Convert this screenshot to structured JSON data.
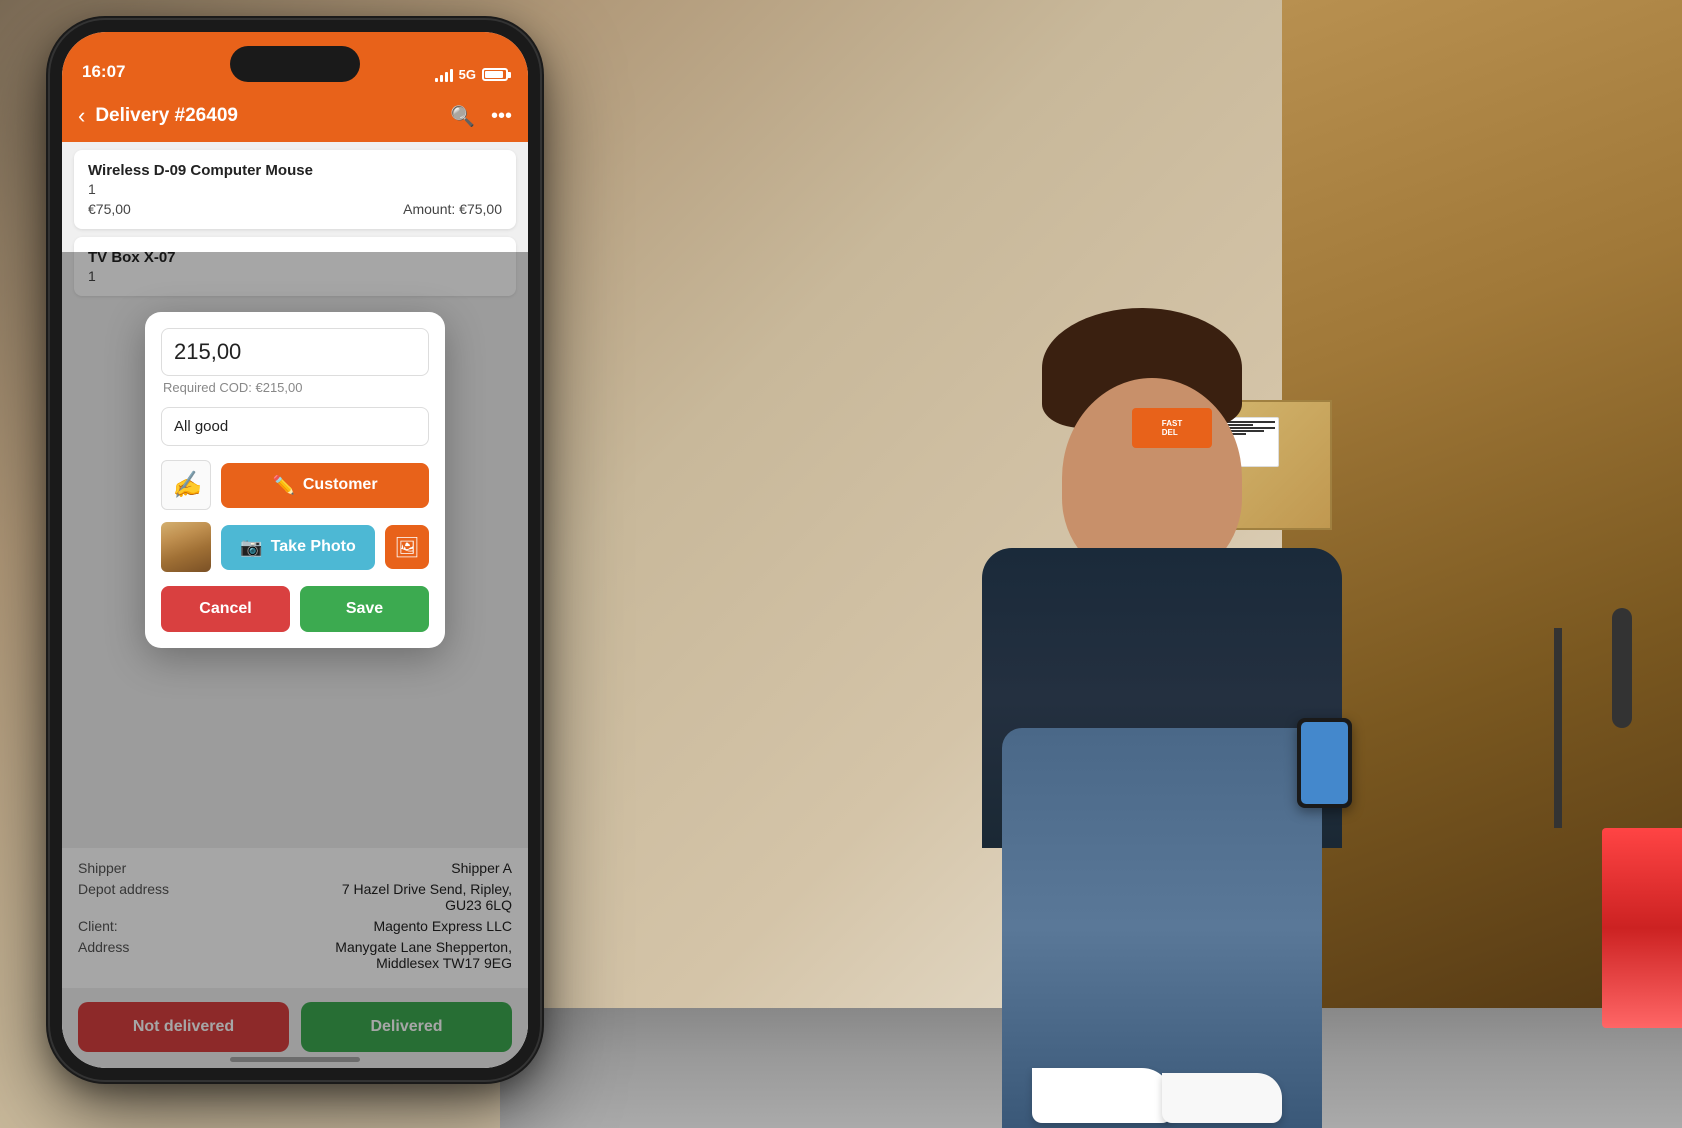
{
  "background": {
    "alt": "Delivery person sitting in van with packages"
  },
  "phone": {
    "status_bar": {
      "time": "16:07",
      "signal": "5G",
      "battery": "90"
    },
    "nav": {
      "title": "Delivery #26409",
      "back_label": "‹",
      "search_icon": "search",
      "more_icon": "•••"
    },
    "items": [
      {
        "name": "Wireless D-09 Computer Mouse",
        "qty": "1",
        "price": "€75,00",
        "amount_label": "Amount:",
        "amount": "€75,00"
      },
      {
        "name": "TV Box X-07",
        "qty": "1"
      }
    ],
    "modal": {
      "amount_value": "215,00",
      "cod_hint": "Required COD: €215,00",
      "notes_value": "All good",
      "signature_placeholder": "✍",
      "customer_btn_label": "Customer",
      "take_photo_btn_label": "Take Photo",
      "add_photo_icon": "🖼",
      "cancel_btn_label": "Cancel",
      "save_btn_label": "Save"
    },
    "info": [
      {
        "label": "Shipper",
        "value": "Shipper A"
      },
      {
        "label": "Depot address",
        "value": "7 Hazel Drive Send, Ripley, GU23 6LQ"
      },
      {
        "label": "Client:",
        "value": "Magento Express LLC"
      },
      {
        "label": "Address",
        "value": "Manygate Lane Shepperton, Middlesex TW17 9EG"
      }
    ],
    "bottom_buttons": {
      "not_delivered": "Not delivered",
      "delivered": "Delivered"
    }
  },
  "colors": {
    "orange": "#E8621A",
    "blue": "#4DB8D4",
    "red": "#D94040",
    "green": "#3CAA50"
  }
}
